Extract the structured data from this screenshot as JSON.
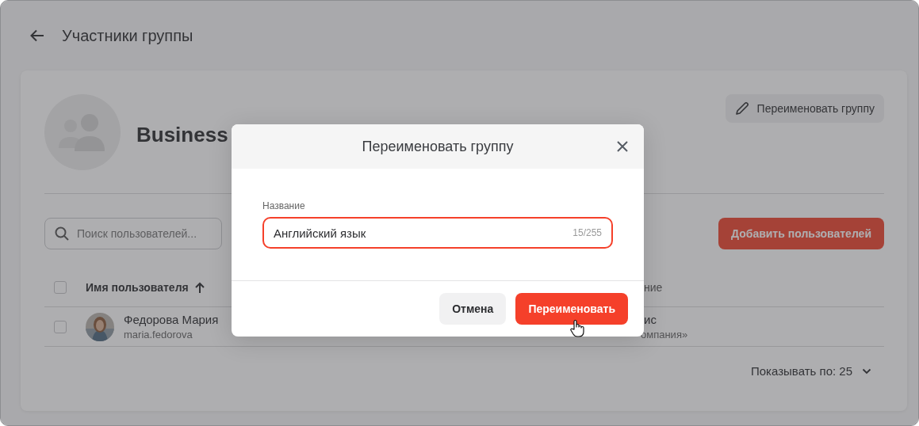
{
  "page": {
    "title": "Участники группы"
  },
  "group": {
    "name": "Business",
    "rename_button": "Переименовать группу"
  },
  "search": {
    "placeholder": "Поиск пользователей..."
  },
  "add_button": "Добавить пользователей",
  "table": {
    "columns": [
      {
        "label": "Имя пользователя",
        "sorted_ascending": true
      },
      {
        "label": "ние"
      }
    ],
    "header_checked": false,
    "rows": [
      {
        "checked": false,
        "name": "Федорова Мария",
        "login": "maria.fedorova",
        "column_2": "ис",
        "column_2_sub": "омпания»"
      }
    ]
  },
  "pager": {
    "label": "Показывать по: 25"
  },
  "dialog": {
    "title": "Переименовать группу",
    "field_label": "Название",
    "value": "Английский язык",
    "counter": "15/255",
    "cancel": "Отмена",
    "confirm": "Переименовать"
  }
}
